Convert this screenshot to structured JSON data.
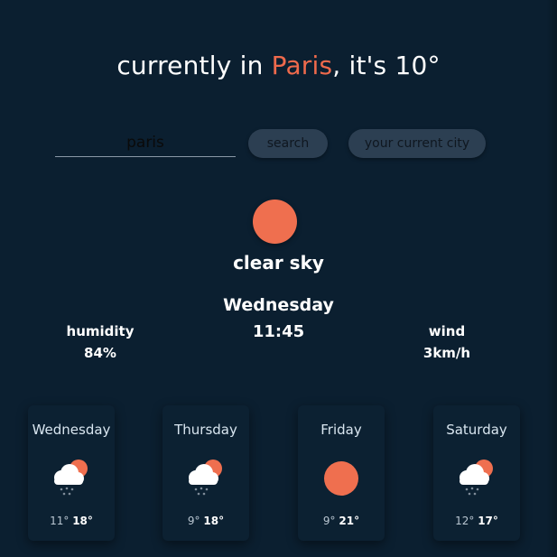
{
  "header": {
    "prefix": "currently in ",
    "city": "Paris",
    "suffix": ", it's 10°"
  },
  "search": {
    "value": "paris",
    "search_label": "search",
    "current_city_label": "your current city"
  },
  "current": {
    "icon": "sun-icon",
    "condition": "clear sky",
    "day": "Wednesday",
    "time": "11:45",
    "humidity_label": "humidity",
    "humidity_value": "84%",
    "wind_label": "wind",
    "wind_value": "3km/h"
  },
  "forecast": [
    {
      "day": "Wednesday",
      "icon": "cloud-rain-sun-icon",
      "min": "11°",
      "max": "18°"
    },
    {
      "day": "Thursday",
      "icon": "cloud-rain-sun-icon",
      "min": "9°",
      "max": "18°"
    },
    {
      "day": "Friday",
      "icon": "sun-icon",
      "min": "9°",
      "max": "21°"
    },
    {
      "day": "Saturday",
      "icon": "cloud-rain-sun-icon",
      "min": "12°",
      "max": "17°"
    }
  ],
  "colors": {
    "background": "#0b1f30",
    "accent": "#ef6a4c",
    "button": "#2c3f52"
  }
}
